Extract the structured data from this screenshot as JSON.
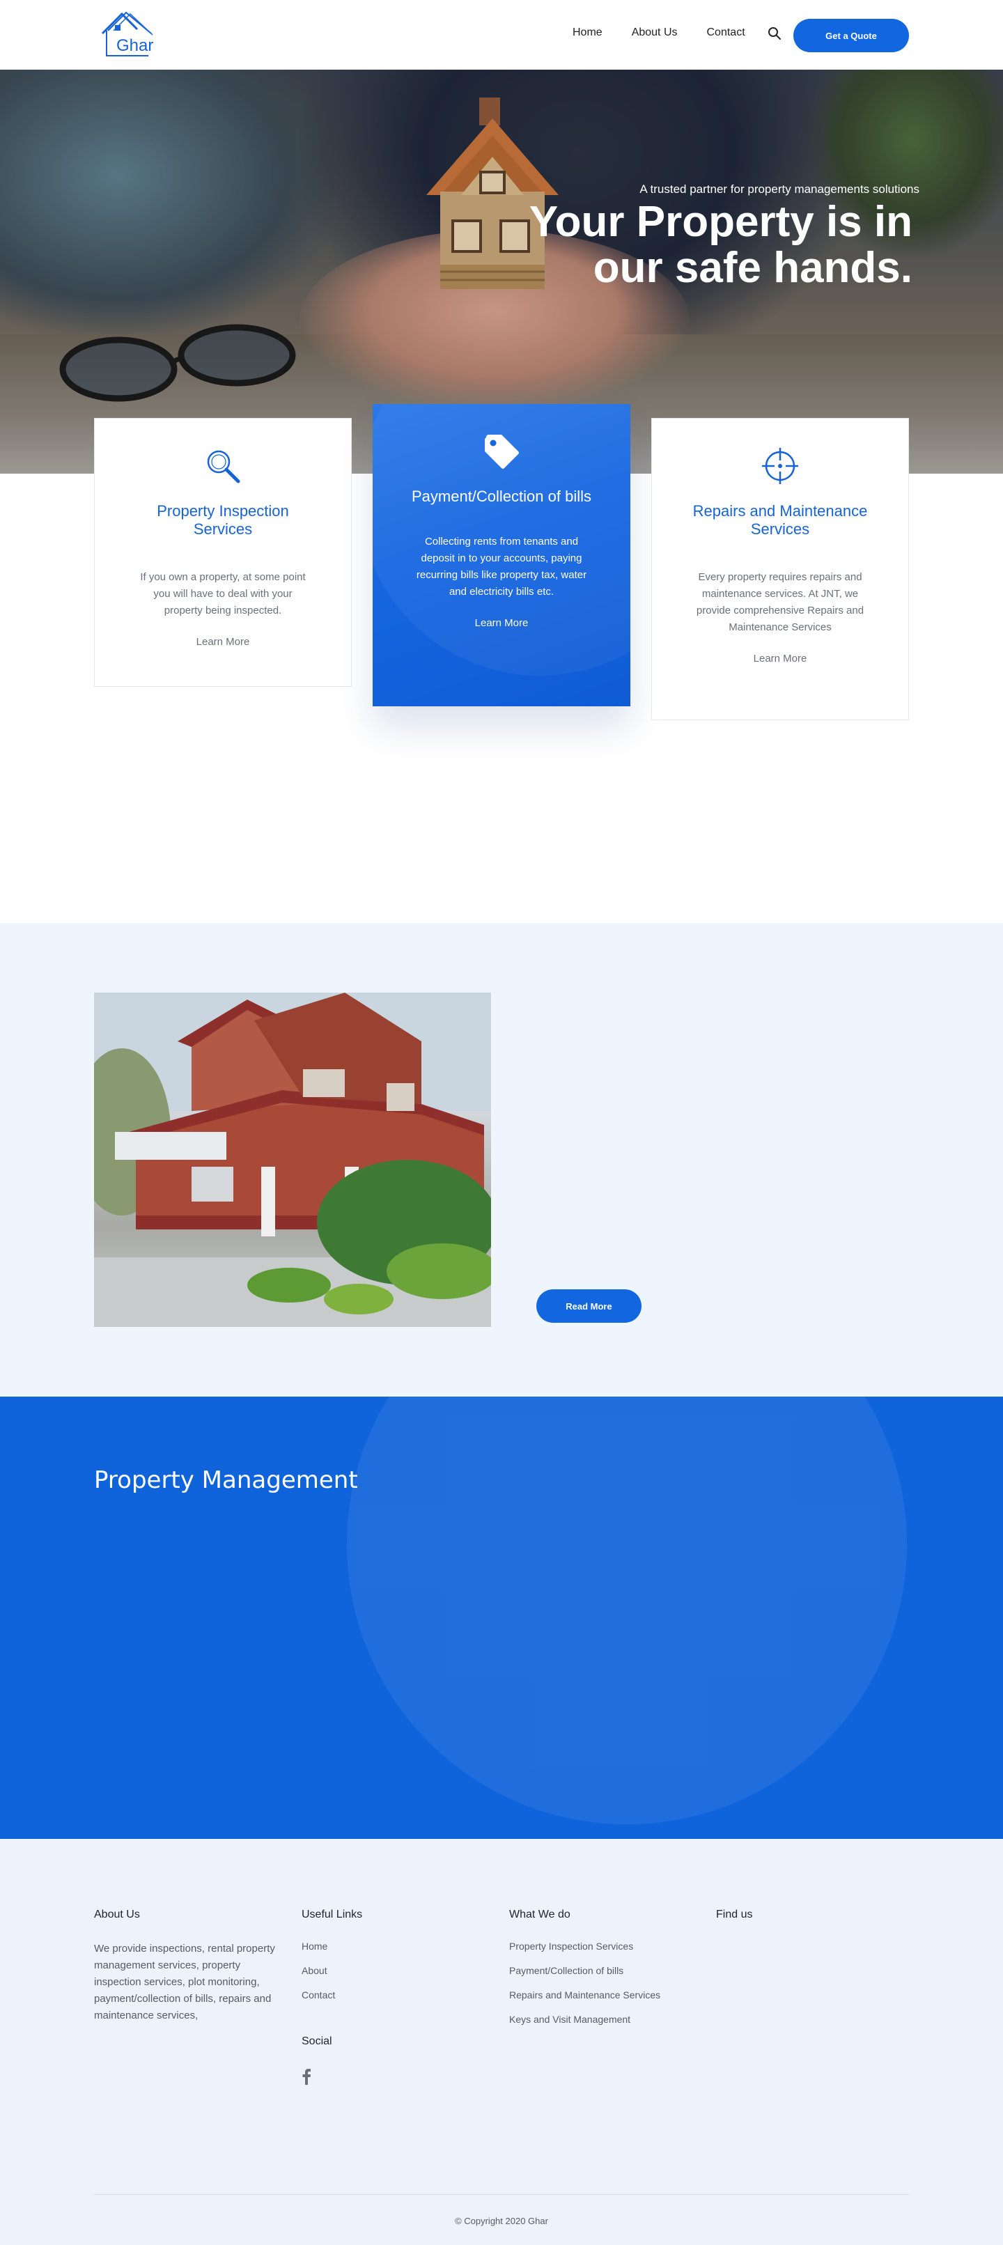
{
  "brand": {
    "name": "Ghar",
    "color": "#1266e0"
  },
  "nav": {
    "items": [
      "Home",
      "About Us",
      "Contact"
    ],
    "quote_label": "Get a Quote"
  },
  "hero": {
    "subtitle": "A trusted partner for property managements solutions",
    "title": "Your Property is in our safe hands."
  },
  "services": [
    {
      "icon": "magnifier-icon",
      "title": "Property Inspection Services",
      "text": "If you own a property, at some point you will have to deal with your property being inspected.",
      "link": "Learn More"
    },
    {
      "icon": "tag-icon",
      "title": "Payment/Collection of bills",
      "text": "Collecting rents from tenants and deposit in to your accounts, paying recurring bills like property tax, water and electricity bills etc.",
      "link": "Learn More"
    },
    {
      "icon": "crosshair-icon",
      "title": "Repairs and Maintenance Services",
      "text": "Every property requires repairs and maintenance services. At JNT, we provide comprehensive Repairs and Maintenance Services",
      "link": "Learn More"
    }
  ],
  "about": {
    "button_label": "Read More"
  },
  "band": {
    "title": "Property Management"
  },
  "footer": {
    "about_title": "About Us",
    "about_text": "We provide inspections, rental property management services, property inspection services, plot monitoring, payment/collection of bills, repairs and maintenance services,",
    "links_title": "Useful Links",
    "links": [
      "Home",
      "About",
      "Contact"
    ],
    "social_title": "Social",
    "social_icon": "facebook-icon",
    "what_title": "What We do",
    "what_items": [
      "Property Inspection Services",
      "Payment/Collection of bills",
      "Repairs and Maintenance Services",
      "Keys and Visit Management"
    ],
    "find_title": "Find us",
    "copyright": "© Copyright 2020 Ghar"
  }
}
